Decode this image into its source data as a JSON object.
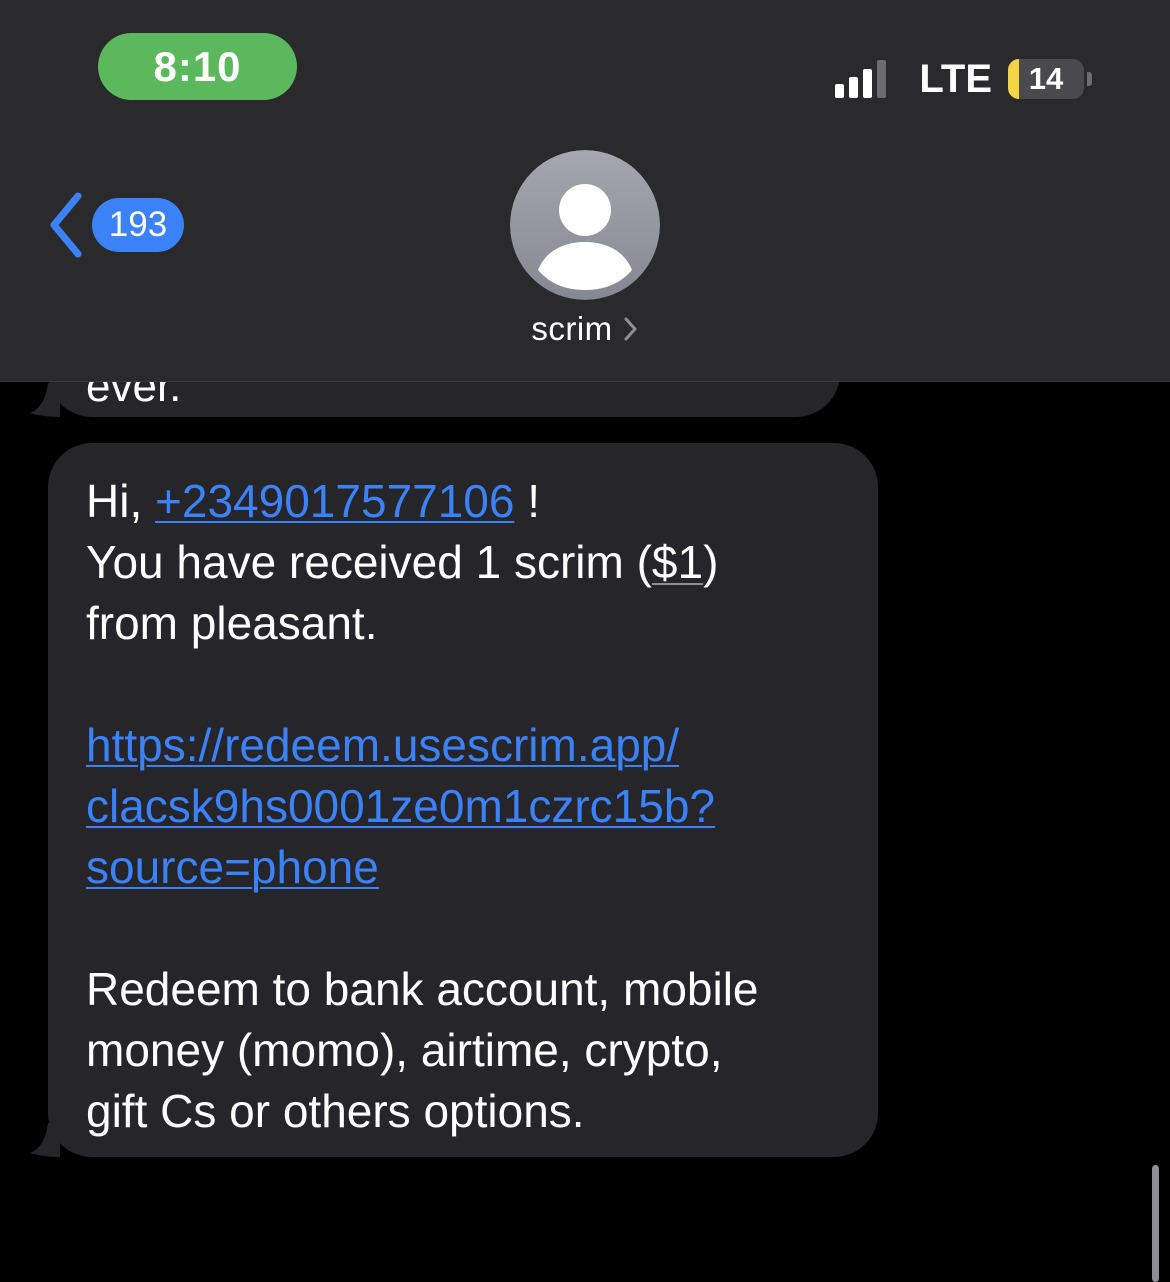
{
  "status_bar": {
    "time": "8:10",
    "network": "LTE",
    "battery_level": "14",
    "battery_fraction": 0.14,
    "signal_bars_active": 3,
    "signal_bars_total": 4,
    "colors": {
      "time_pill": "#5cb85c",
      "battery_fill": "#f5d546"
    }
  },
  "header": {
    "back_badge_count": "193",
    "contact_name": "scrim",
    "back_icon": "chevron-left-icon",
    "avatar_icon": "person-silhouette-icon",
    "contact_chevron_icon": "chevron-right-icon"
  },
  "messages": [
    {
      "id": "previous",
      "partial_text": "ever."
    },
    {
      "id": "main",
      "greeting": "Hi, ",
      "phone_link": "+2349017577106",
      "greeting_end": " !",
      "received_prefix": "You have received 1 scrim (",
      "amount": "$1",
      "received_suffix": ")",
      "from_line": "from pleasant.",
      "url_lines": [
        "https://redeem.usescrim.app/",
        "clacsk9hs0001ze0m1czrc15b?",
        "source=phone"
      ],
      "body_lines": [
        "Redeem to bank account, mobile",
        "money (momo), airtime, crypto,",
        "gift Cs or others options."
      ]
    }
  ],
  "theme": {
    "background": "#000000",
    "bubble": "#26252a",
    "header": "#2a2a2c",
    "link": "#3b82f6"
  }
}
